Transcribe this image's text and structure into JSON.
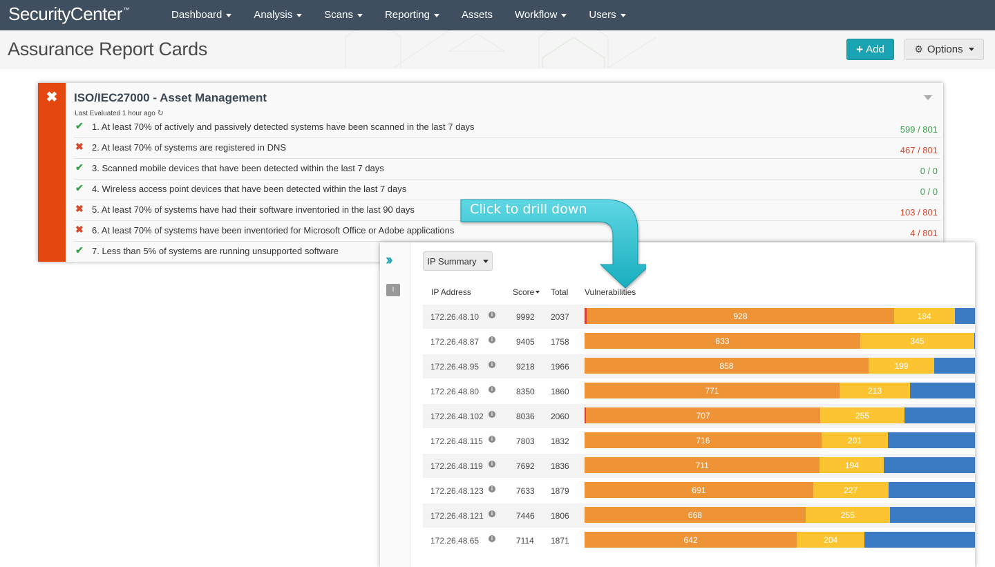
{
  "app": {
    "logo": "SecurityCenter",
    "logo_mark": "™"
  },
  "nav": {
    "items": [
      {
        "label": "Dashboard",
        "dropdown": true
      },
      {
        "label": "Analysis",
        "dropdown": true
      },
      {
        "label": "Scans",
        "dropdown": true
      },
      {
        "label": "Reporting",
        "dropdown": true
      },
      {
        "label": "Assets",
        "dropdown": false
      },
      {
        "label": "Workflow",
        "dropdown": true
      },
      {
        "label": "Users",
        "dropdown": true
      }
    ]
  },
  "header": {
    "title": "Assurance Report Cards",
    "add_label": "Add",
    "options_label": "Options"
  },
  "card": {
    "status": "fail",
    "title": "ISO/IEC27000 - Asset Management",
    "last_evaluated": "Last Evaluated 1 hour ago",
    "rules": [
      {
        "text": "1. At least 70% of actively and passively detected systems have been scanned in the last 7 days",
        "score": "599 / 801",
        "status": "pass"
      },
      {
        "text": "2. At least 70% of systems are registered in DNS",
        "score": "467 / 801",
        "status": "fail"
      },
      {
        "text": "3. Scanned mobile devices that have been detected within the last 7 days",
        "score": "0 / 0",
        "status": "pass"
      },
      {
        "text": "4. Wireless access point devices that have been detected within the last 7 days",
        "score": "0 / 0",
        "status": "pass"
      },
      {
        "text": "5. At least 70% of systems have had their software inventoried in the last 90 days",
        "score": "103 / 801",
        "status": "fail"
      },
      {
        "text": "6. At least 70% of systems have been inventoried for Microsoft Office or Adobe applications",
        "score": "4 / 801",
        "status": "fail"
      },
      {
        "text": "7. Less than 5% of systems are running unsupported software",
        "score": "",
        "status": "pass"
      }
    ]
  },
  "callout": {
    "text": "Click to drill down"
  },
  "panel": {
    "view_label": "IP Summary",
    "side_mini_label": "I",
    "columns": {
      "ip": "IP Address",
      "score": "Score",
      "total": "Total",
      "vulns": "Vulnerabilities"
    },
    "colors": {
      "critical": "#d43f3a",
      "high": "#ee9336",
      "medium": "#fdc431",
      "low": "#3a7bc4"
    },
    "rows": [
      {
        "ip": "172.26.48.10",
        "score": "9992",
        "total": "2037",
        "critical": 7,
        "high": 928,
        "medium": 184,
        "low": 918,
        "high_label": "928",
        "medium_label": "184"
      },
      {
        "ip": "172.26.48.87",
        "score": "9405",
        "total": "1758",
        "critical": 0,
        "high": 833,
        "medium": 345,
        "low": 580,
        "high_label": "833",
        "medium_label": "345"
      },
      {
        "ip": "172.26.48.95",
        "score": "9218",
        "total": "1966",
        "critical": 0,
        "high": 858,
        "medium": 199,
        "low": 909,
        "high_label": "858",
        "medium_label": "199"
      },
      {
        "ip": "172.26.48.80",
        "score": "8350",
        "total": "1860",
        "critical": 0,
        "high": 771,
        "medium": 213,
        "low": 876,
        "high_label": "771",
        "medium_label": "213"
      },
      {
        "ip": "172.26.48.102",
        "score": "8036",
        "total": "2060",
        "critical": 5,
        "high": 707,
        "medium": 255,
        "low": 1093,
        "high_label": "707",
        "medium_label": "255"
      },
      {
        "ip": "172.26.48.115",
        "score": "7803",
        "total": "1832",
        "critical": 0,
        "high": 716,
        "medium": 201,
        "low": 915,
        "high_label": "716",
        "medium_label": "201"
      },
      {
        "ip": "172.26.48.119",
        "score": "7692",
        "total": "1836",
        "critical": 0,
        "high": 711,
        "medium": 194,
        "low": 931,
        "high_label": "711",
        "medium_label": "194"
      },
      {
        "ip": "172.26.48.123",
        "score": "7633",
        "total": "1879",
        "critical": 0,
        "high": 691,
        "medium": 227,
        "low": 961,
        "high_label": "691",
        "medium_label": "227"
      },
      {
        "ip": "172.26.48.121",
        "score": "7446",
        "total": "1806",
        "critical": 0,
        "high": 668,
        "medium": 255,
        "low": 883,
        "high_label": "668",
        "medium_label": "255"
      },
      {
        "ip": "172.26.48.65",
        "score": "7114",
        "total": "1871",
        "critical": 0,
        "high": 642,
        "medium": 204,
        "low": 1025,
        "high_label": "642",
        "medium_label": "204"
      }
    ]
  }
}
